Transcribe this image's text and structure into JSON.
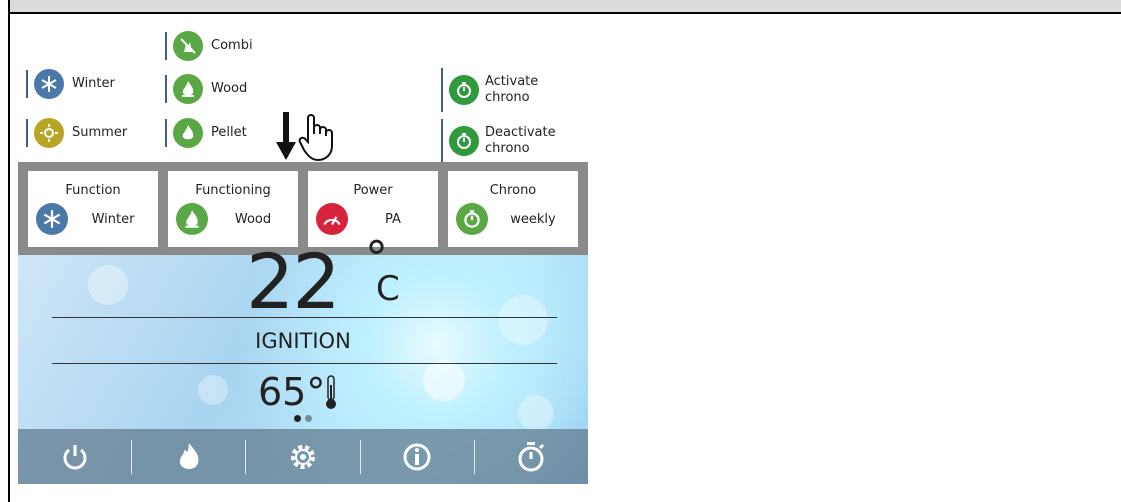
{
  "options": {
    "combi": "Combi",
    "winter": "Winter",
    "wood": "Wood",
    "summer": "Summer",
    "pellet": "Pellet",
    "activate_chrono": [
      "Activate",
      "chrono"
    ],
    "deactivate_chrono": [
      "Deactivate",
      "chrono"
    ]
  },
  "tiles": [
    {
      "title": "Function",
      "value": "Winter",
      "icon": "snowflake-icon",
      "color": "#4a78a8"
    },
    {
      "title": "Functioning",
      "value": "Wood",
      "icon": "flame-icon",
      "color": "#5aa845"
    },
    {
      "title": "Power",
      "value": "PA",
      "icon": "gauge-icon",
      "color": "#d8243a"
    },
    {
      "title": "Chrono",
      "value": "weekly",
      "icon": "stopwatch-icon",
      "color": "#5aa845"
    }
  ],
  "display": {
    "temperature": "22",
    "unit_symbol": "°",
    "unit": "C",
    "status": "IGNITION",
    "water_temp": "65°"
  },
  "toolbar": [
    "power-icon",
    "flame-icon",
    "gear-icon",
    "info-icon",
    "stopwatch-icon"
  ],
  "colors": {
    "winter": "#4a78a8",
    "summer": "#b8a425",
    "green": "#5aa845",
    "chrono": "#2f9a3c",
    "power": "#d8243a"
  }
}
